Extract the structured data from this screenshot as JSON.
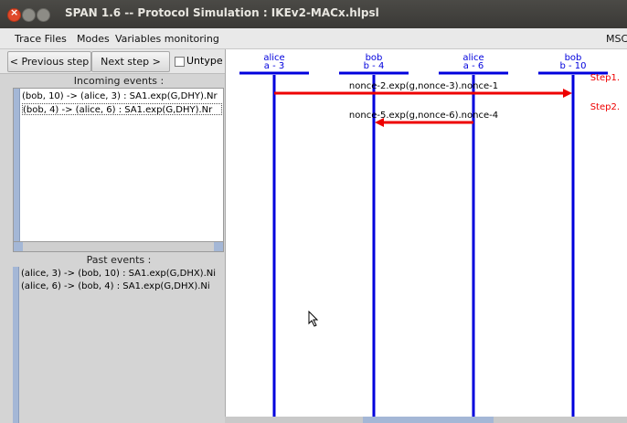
{
  "window": {
    "title": "SPAN 1.6 -- Protocol Simulation : IKEv2-MACx.hlpsl"
  },
  "menu": {
    "items": [
      "Trace Files",
      "Modes",
      "Variables monitoring"
    ],
    "right_label": "MSC"
  },
  "controls": {
    "prev_label": "< Previous step",
    "next_label": "Next step >",
    "untype_label": "Untype",
    "untype_checked": false
  },
  "incoming": {
    "title": "Incoming events :",
    "events": [
      "(bob, 10) -> (alice, 3) : SA1.exp(G,DHY).Nr",
      "(bob, 4) -> (alice, 6) : SA1.exp(G,DHY).Nr"
    ]
  },
  "past": {
    "title": "Past events :",
    "events": [
      "(alice, 3) -> (bob, 10) : SA1.exp(G,DHX).Ni",
      "(alice, 6) -> (bob, 4) : SA1.exp(G,DHX).Ni"
    ]
  },
  "diagram": {
    "agents": [
      {
        "name": "alice",
        "instance": "a - 3"
      },
      {
        "name": "bob",
        "instance": "b - 4"
      },
      {
        "name": "alice",
        "instance": "a - 6"
      },
      {
        "name": "bob",
        "instance": "b - 10"
      }
    ],
    "messages": [
      {
        "label": "nonce-2.exp(g,nonce-3).nonce-1",
        "from": 0,
        "to": 3,
        "step": "Step1."
      },
      {
        "label": "nonce-5.exp(g,nonce-6).nonce-4",
        "from": 2,
        "to": 1,
        "step": "Step2."
      }
    ],
    "colors": {
      "lifeline": "#0000dd",
      "arrow": "#ee0000",
      "step": "#ee0000"
    }
  }
}
